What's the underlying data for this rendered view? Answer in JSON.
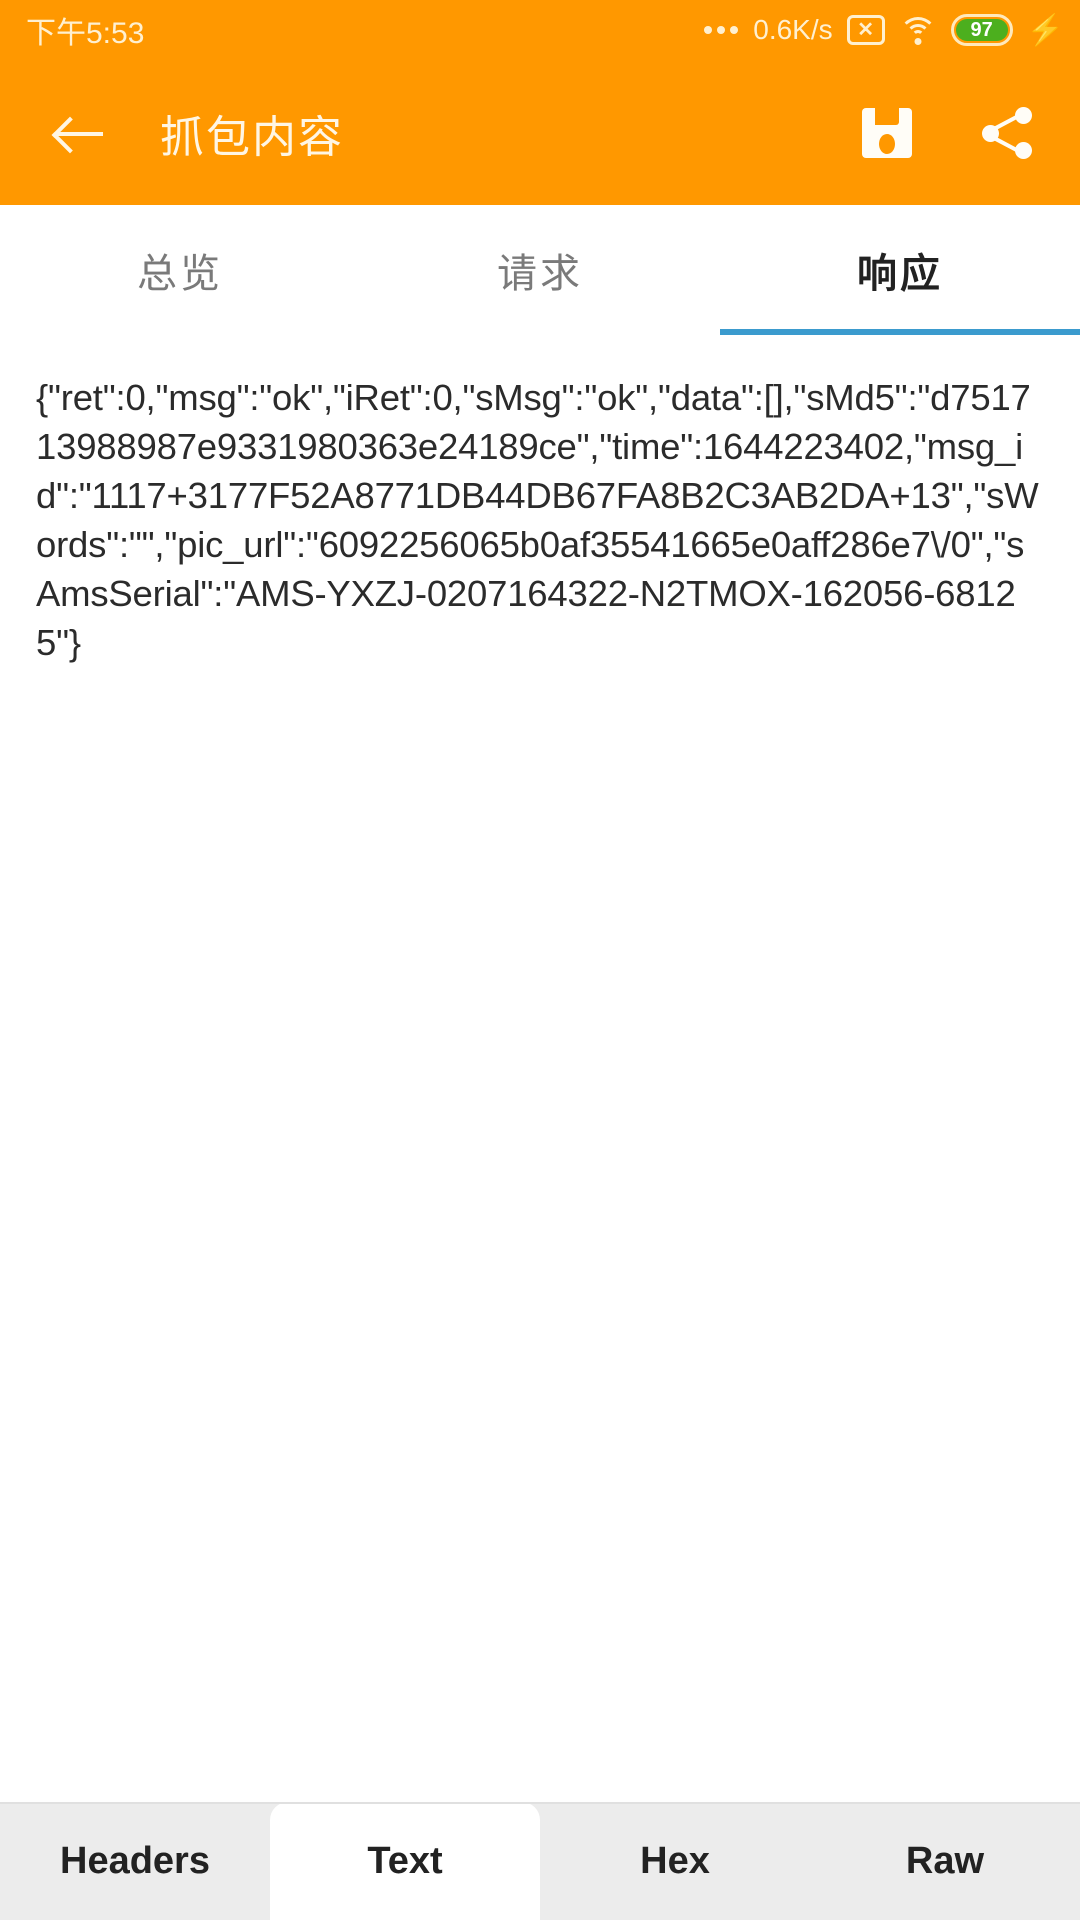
{
  "statusbar": {
    "clock": "下午5:53",
    "netspeed": "0.6K/s",
    "sim_icon": "sim-card-x-icon",
    "wifi_icon": "wifi-icon",
    "battery_level": "97",
    "battery_color": "#4CAF1E",
    "charging_icon": "charging-bolt-icon"
  },
  "appbar": {
    "background": "#FF9800",
    "back_icon": "back-arrow-icon",
    "title": "抓包内容",
    "save_icon": "save-floppy-icon",
    "share_icon": "share-nodes-icon"
  },
  "tabs": {
    "items": [
      {
        "label": "总览",
        "active": false
      },
      {
        "label": "请求",
        "active": false
      },
      {
        "label": "响应",
        "active": true
      }
    ],
    "indicator_color": "#3B9BCE"
  },
  "content": {
    "body": "{\"ret\":0,\"msg\":\"ok\",\"iRet\":0,\"sMsg\":\"ok\",\"data\":[],\"sMd5\":\"d751713988987e9331980363e24189ce\",\"time\":1644223402,\"msg_id\":\"1117+3177F52A8771DB44DB67FA8B2C3AB2DA+13\",\"sWords\":\"\",\"pic_url\":\"6092256065b0af35541665e0aff286e7\\/0\",\"sAmsSerial\":\"AMS-YXZJ-0207164322-N2TMOX-162056-68125\"}"
  },
  "bottombar": {
    "items": [
      {
        "label": "Headers",
        "active": false
      },
      {
        "label": "Text",
        "active": true
      },
      {
        "label": "Hex",
        "active": false
      },
      {
        "label": "Raw",
        "active": false
      }
    ]
  }
}
